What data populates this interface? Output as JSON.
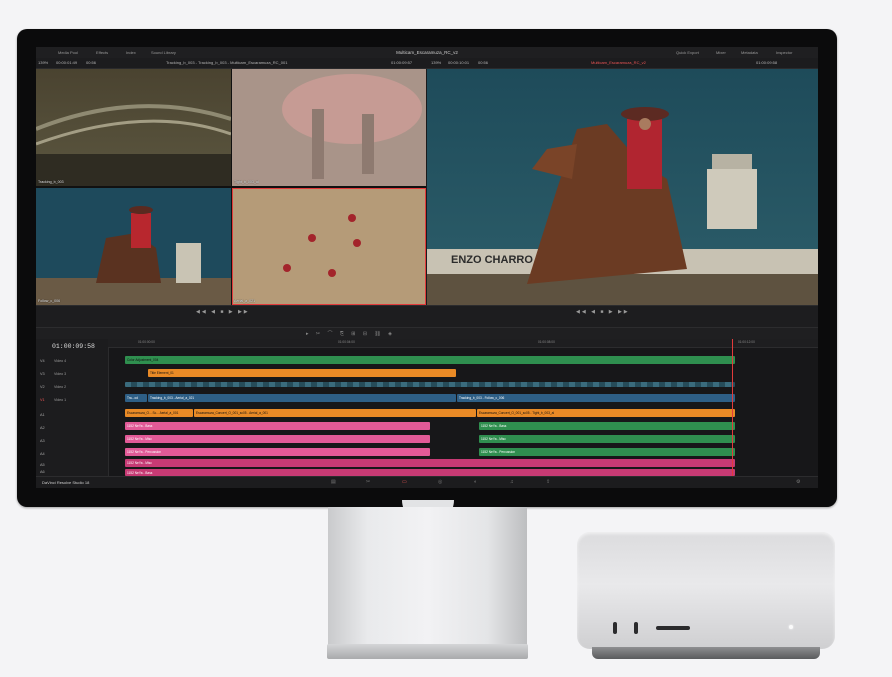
{
  "app": {
    "name": "DaVinci Resolve Studio 18",
    "project_title": "Multicam_Escaramuza_RC_v2"
  },
  "menubar": {
    "left_items": [
      "Media Pool",
      "Effects",
      "Index",
      "Sound Library"
    ],
    "right_items": [
      "Quick Export",
      "Mixer",
      "Metadata",
      "Inspector"
    ]
  },
  "source_bar": {
    "zoom": "139%",
    "source_timecode": "00:00:01:49",
    "duration": "00:56",
    "clip_name": "Tracking_b_003 - Tracking_b_003 - Multicam_Escaramuza_RC_001",
    "position": "01:00:09:57"
  },
  "record_bar": {
    "zoom": "139%",
    "timecode": "00:00:10:01",
    "duration": "00:56",
    "timeline_name": "Multicam_Escaramuza_RC_v2",
    "position": "01:00:09:58"
  },
  "multicam_angles": [
    {
      "label": "Tracking_b_003"
    },
    {
      "label": "Tight_b_003_al"
    },
    {
      "label": "Follow_c_006"
    },
    {
      "label": "Aerial_a_021",
      "selected": true
    }
  ],
  "viewer": {
    "sign_text": "ENZO CHARRO"
  },
  "timeline": {
    "timecode": "01:00:09:58",
    "ruler_ticks": [
      "01:00:00:00",
      "01:00:04:00",
      "01:00:08:00",
      "01:00:12:00"
    ],
    "tracks": [
      {
        "id": "V4",
        "name": "Video 4"
      },
      {
        "id": "V3",
        "name": "Video 3"
      },
      {
        "id": "V2",
        "name": "Video 2"
      },
      {
        "id": "V1",
        "name": "Video 1"
      },
      {
        "id": "A1",
        "name": ""
      },
      {
        "id": "A2",
        "name": ""
      },
      {
        "id": "A3",
        "name": ""
      },
      {
        "id": "A4",
        "name": ""
      },
      {
        "id": "A5",
        "name": ""
      },
      {
        "id": "A6",
        "name": ""
      }
    ],
    "clips": {
      "v4": "Color Adjustment_004",
      "v3": "Title Element_01",
      "v1_a": "Tra...od",
      "v1_b": "Tracking_b_003 - Aerial_a_021",
      "v1_c": "Tracking_b_003 - Follow_c_006",
      "a1_a": "Escaramuza_O... Sc... Aerial_a_001",
      "a1_b": "Escaramuza_Concert_O_001_sc05 - Aerial_a_001",
      "a1_c": "Escaramuza_Concert_O_001_sc05 - Tight_b_003_al",
      "a_left": "1152 NeYa - Bass",
      "a_right": "1152 NeYa - Bass",
      "a_left2": "1152 NeYa - Misc",
      "a_left3": "1152 NeYa - Percussion",
      "a_left4": "1152 NeYa - Bass",
      "a5": "1152 NeYa - Misc",
      "a6": "1152 NeYa - Bass"
    }
  },
  "colors": {
    "green_clip": "#2f8f4f",
    "orange_clip": "#e98a26",
    "pink_clip": "#e25a97",
    "magenta_clip": "#c73a74",
    "blue_clip": "#2e5f86",
    "playhead": "#e23b3b"
  }
}
